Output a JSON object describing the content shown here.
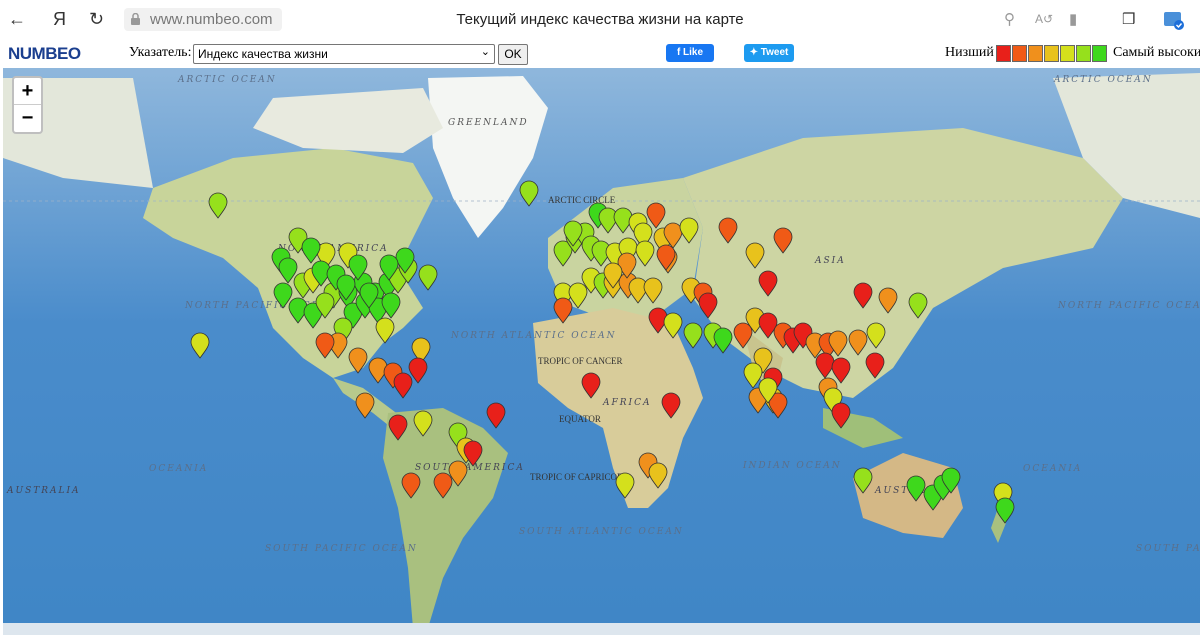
{
  "browser": {
    "back_icon": "arrow-left-icon",
    "yandex_icon": "yandex-logo-icon",
    "reload_icon": "reload-icon",
    "url": "www.numbeo.com",
    "page_title": "Текущий индекс качества жизни на карте"
  },
  "toolbar": {
    "logo": "NUMBEO",
    "indicator_label": "Указатель:",
    "indicator_value": "Индекс качества жизни",
    "ok_label": "OK",
    "fb_label": "Like",
    "tw_label": "Tweet",
    "legend_low": "Низший",
    "legend_high": "Самый высокий",
    "legend_colors": [
      "#e8201a",
      "#f05a16",
      "#f0901c",
      "#e8c21c",
      "#d4e01c",
      "#96e01c",
      "#3ed81c"
    ]
  },
  "map": {
    "zoom_in": "+",
    "zoom_out": "−",
    "labels": {
      "arctic_ocean": "ARCTIC OCEAN",
      "greenland": "GREENLAND",
      "arctic_circle": "ARCTIC CIRCLE",
      "north_america": "NORTH AMERICA",
      "asia": "ASIA",
      "north_pacific": "NORTH PACIFIC OCEAN",
      "north_atlantic": "NORTH ATLANTIC OCEAN",
      "tropic_cancer": "TROPIC OF CANCER",
      "africa": "AFRICA",
      "equator": "EQUATOR",
      "oceania": "OCEANIA",
      "australia": "AUSTRALIA",
      "south_america": "SOUTH AMERICA",
      "tropic_capricorn": "TROPIC OF CAPRICORN",
      "indian_ocean": "INDIAN OCEAN",
      "south_atlantic": "SOUTH ATLANTIC OCEAN",
      "south_pacific": "SOUTH PACIFIC OCEAN"
    }
  }
}
